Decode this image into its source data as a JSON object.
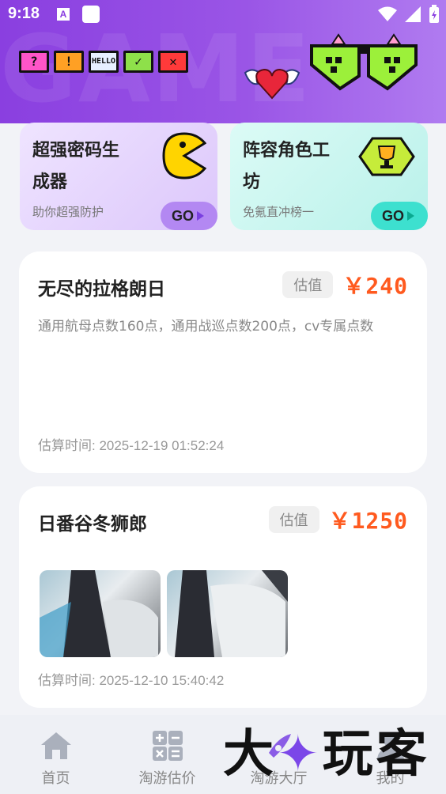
{
  "status_bar": {
    "time": "9:18",
    "a_icon": "A"
  },
  "header": {
    "watermark": "GAME",
    "pixel_buttons": [
      "?",
      "!",
      "HELLO",
      "✓",
      "✕"
    ]
  },
  "features": [
    {
      "title": "超强密码生成器",
      "subtitle": "助你超强防护",
      "go": "GO",
      "icon": "pacman-icon"
    },
    {
      "title": "阵容角色工坊",
      "subtitle": "免氪直冲榜一",
      "go": "GO",
      "icon": "trophy-icon"
    }
  ],
  "cards": [
    {
      "title": "无尽的拉格朗日",
      "badge": "估值",
      "price": "￥240",
      "description": "通用航母点数160点，通用战巡点数200点，cv专属点数",
      "time": "估算时间: 2025-12-19 01:52:24"
    },
    {
      "title": "日番谷冬狮郎",
      "badge": "估值",
      "price": "￥1250",
      "time": "估算时间: 2025-12-10 15:40:42"
    }
  ],
  "nav": [
    {
      "label": "首页",
      "icon": "home-icon"
    },
    {
      "label": "淘游估价",
      "icon": "calculator-icon"
    },
    {
      "label": "淘游大厅",
      "icon": "hall-icon"
    },
    {
      "label": "我的",
      "icon": "profile-icon"
    }
  ],
  "brand_watermark": {
    "part1": "大",
    "part2": "玩客"
  },
  "colors": {
    "header_purple": "#8a3fe0",
    "price_orange": "#ff5a1f",
    "go_purple": "#b388f2",
    "go_teal": "#3de0cf"
  }
}
